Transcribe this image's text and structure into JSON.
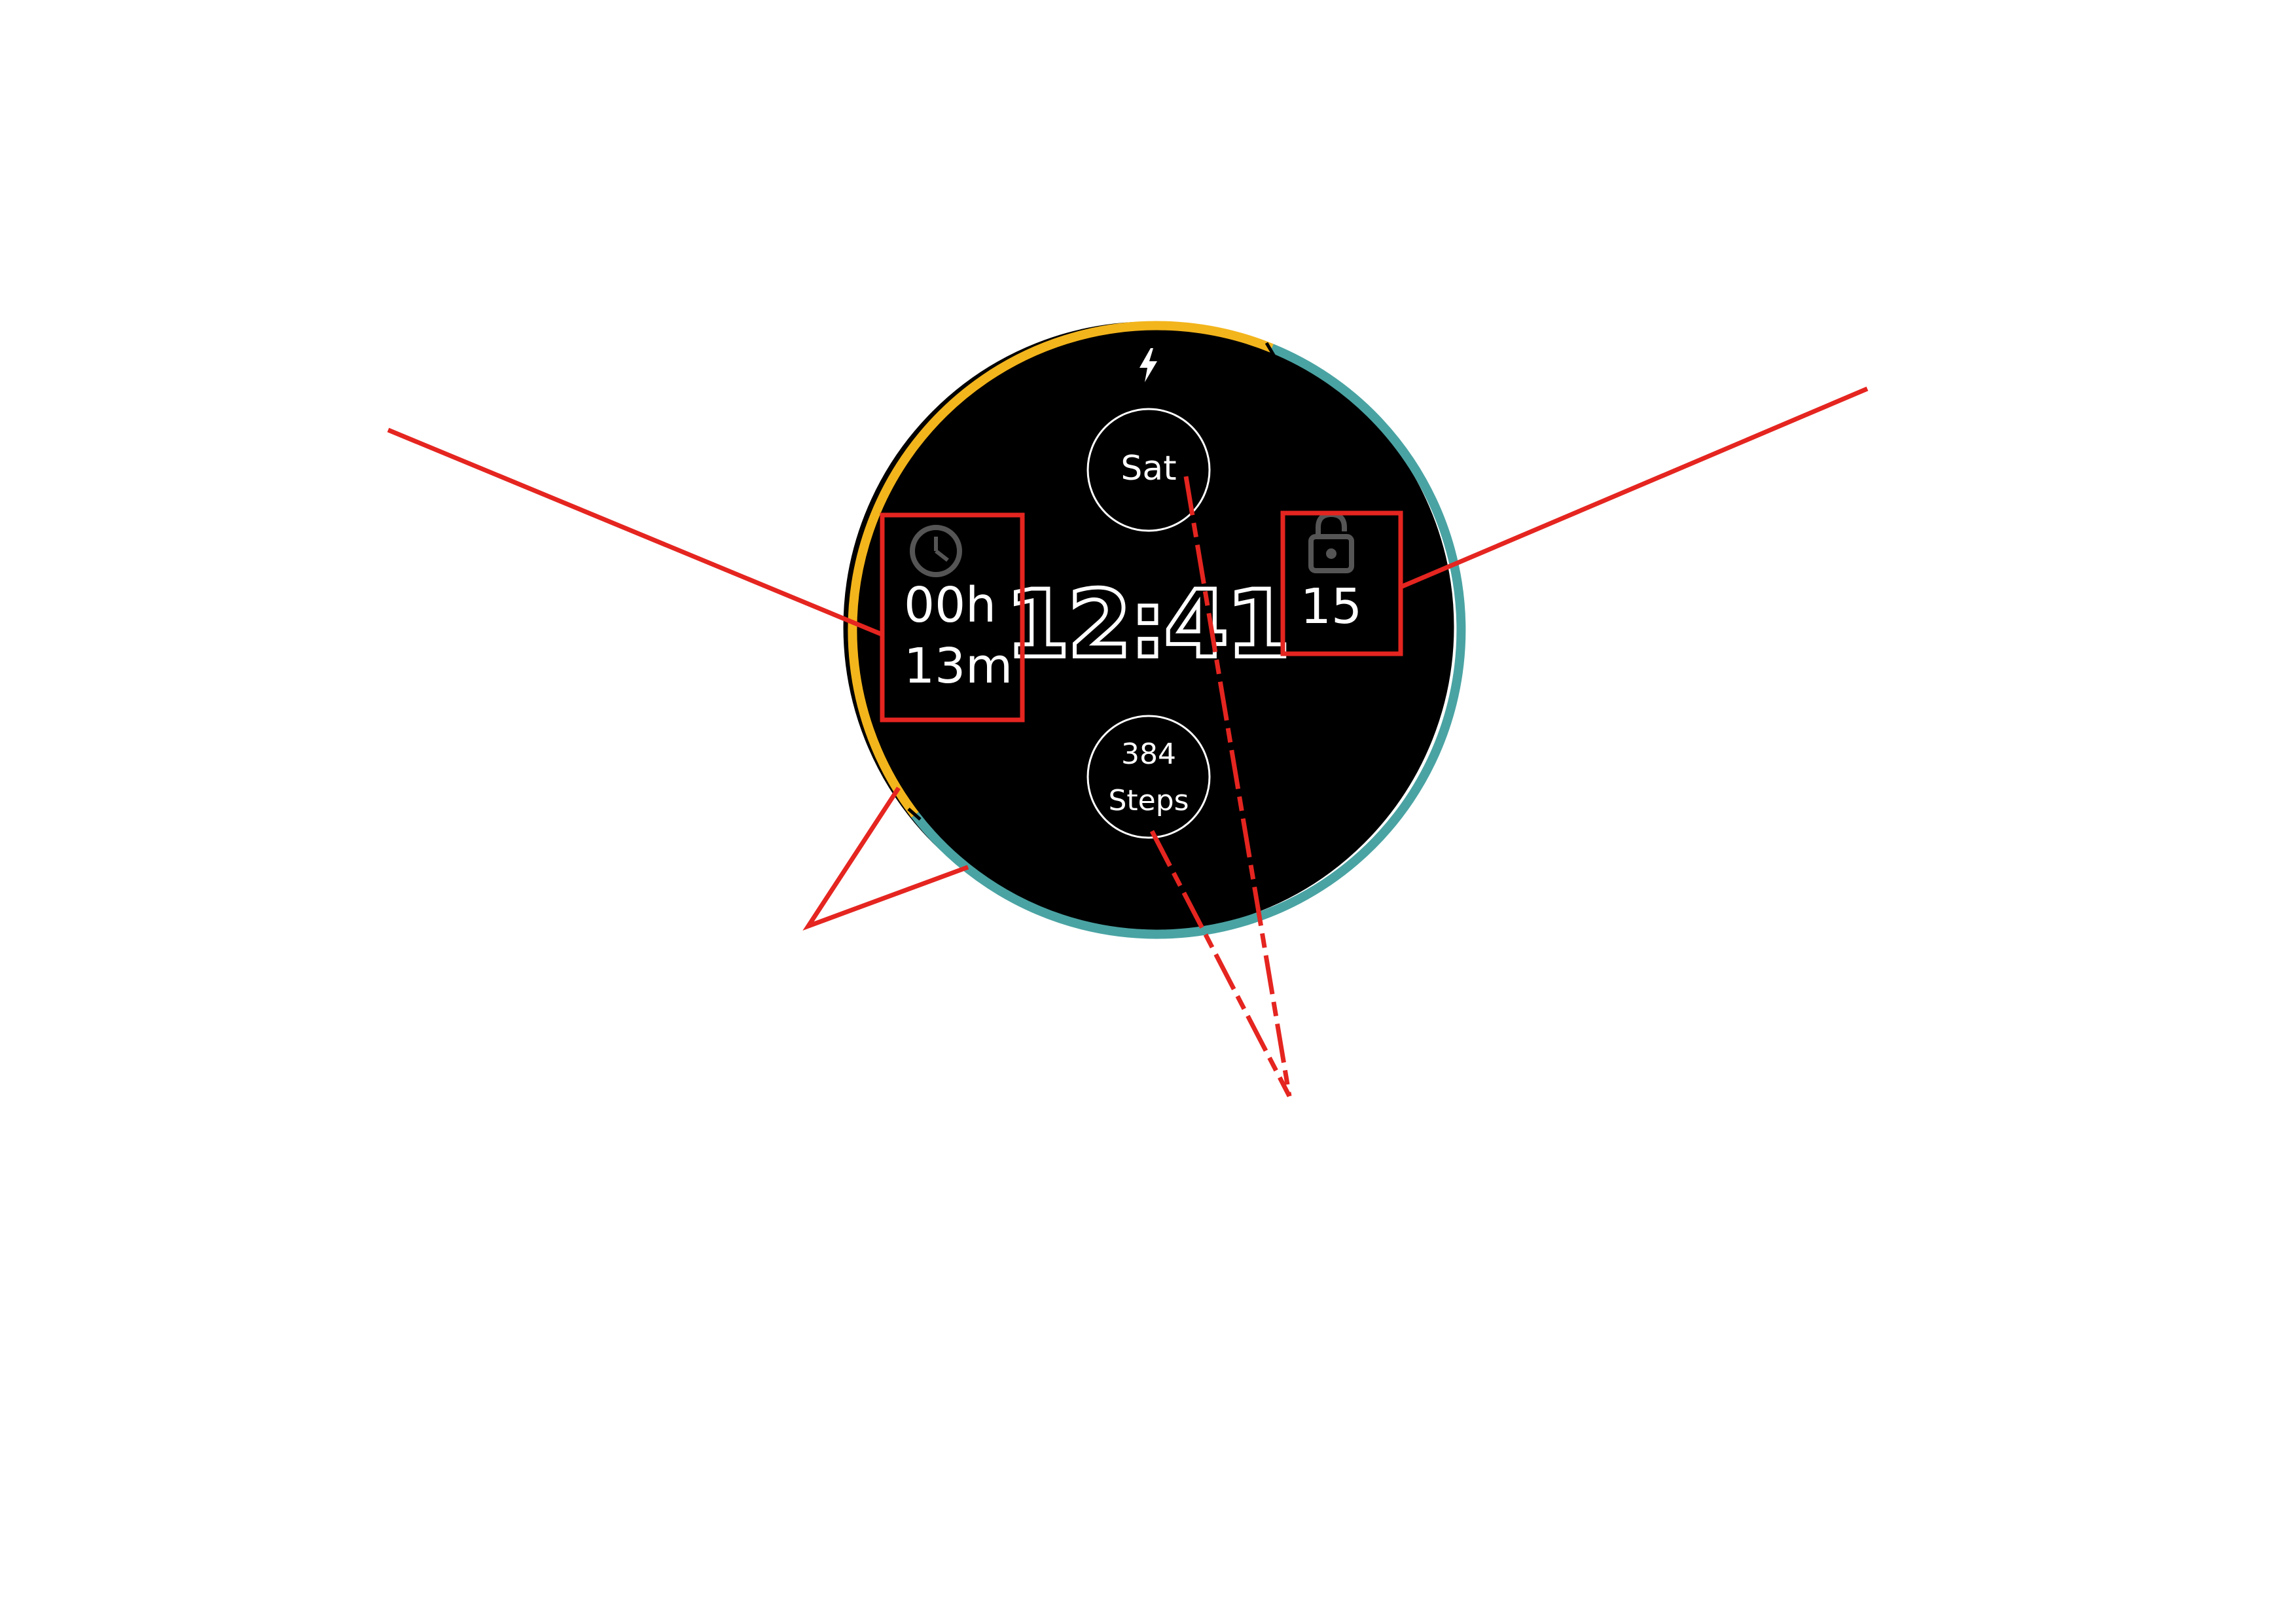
{
  "watch_face": {
    "time": "12:41",
    "day": "Sat",
    "steps": {
      "value": "384",
      "label": "Steps"
    },
    "timer": {
      "hours": "00h",
      "minutes": "13m",
      "icon": "clock-icon"
    },
    "unlock": {
      "value": "15",
      "icon": "unlock-icon"
    },
    "top_icon": "bolt-icon",
    "progress_fraction": 0.38
  },
  "colors": {
    "background": "#ffffff",
    "face": "#000000",
    "progress": "#f3b51c",
    "ring": "#4aa3a3",
    "text": "#ffffff",
    "icon_gray": "#555555",
    "annotation": "#e52520"
  }
}
